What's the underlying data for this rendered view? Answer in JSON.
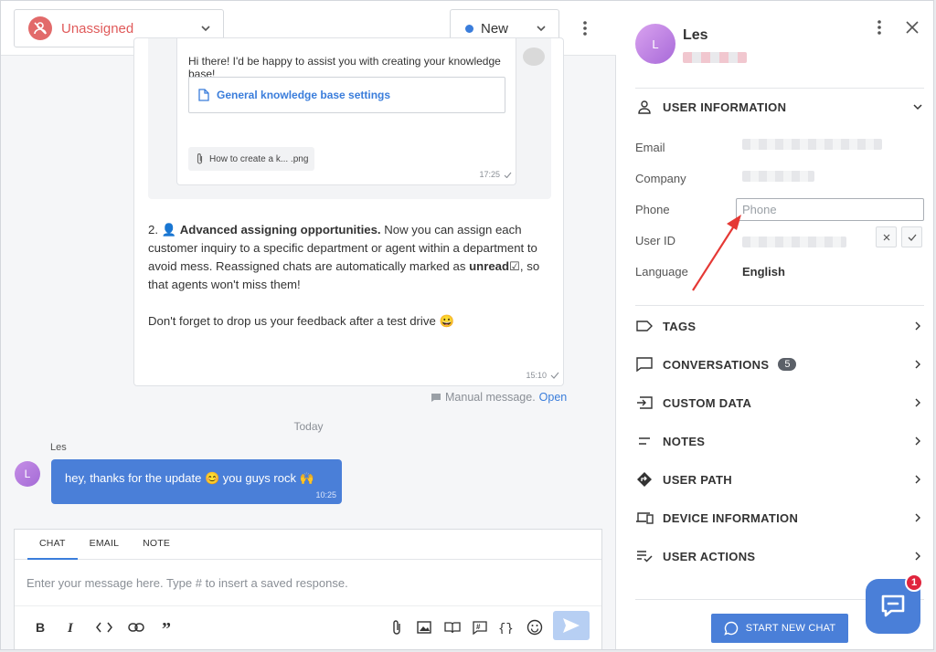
{
  "header": {
    "assignee_label": "Unassigned",
    "status_label": "New",
    "status_color": "#3a7ddb"
  },
  "thread": {
    "inner_message": "Hi there! I'd be happy to assist you with creating your knowledge base!",
    "kb_link_label": "General knowledge base settings",
    "attachment_name": "How to create a k... .png",
    "inner_time": "17:25",
    "paragraph_1_prefix": "2. ",
    "paragraph_1_bold": "Advanced assigning opportunities.",
    "paragraph_1_text": " Now you can assign each customer inquiry to a specific department or agent within a department to avoid mess. Reassigned chats are automatically marked as ",
    "paragraph_1_bold2": "unread",
    "paragraph_1_end": ", so that agents won't miss them!",
    "paragraph_2": "Don't forget to drop us your feedback after a test drive 😀",
    "message_time": "15:10",
    "manual_label": "Manual message.",
    "manual_open": "Open",
    "day_separator": "Today",
    "visitor_name": "Les",
    "visitor_initial": "L",
    "visitor_message": "hey, thanks for the update 😊  you guys rock 🙌",
    "visitor_time": "10:25"
  },
  "composer": {
    "tabs": [
      "CHAT",
      "EMAIL",
      "NOTE"
    ],
    "active_tab": "CHAT",
    "placeholder": "Enter your message here. Type # to insert a saved response."
  },
  "profile": {
    "name": "Les",
    "initial": "L",
    "user_info_title": "USER INFORMATION",
    "fields": {
      "email_label": "Email",
      "company_label": "Company",
      "phone_label": "Phone",
      "phone_placeholder": "Phone",
      "user_id_label": "User ID",
      "language_label": "Language",
      "language_value": "English"
    },
    "sections": {
      "tags": "TAGS",
      "conversations": "CONVERSATIONS",
      "conversations_count": "5",
      "custom_data": "CUSTOM DATA",
      "notes": "NOTES",
      "user_path": "USER PATH",
      "device_information": "DEVICE INFORMATION",
      "user_actions": "USER ACTIONS"
    },
    "start_chat_label": "START NEW CHAT",
    "widget_badge": "1",
    "accent_color": "#4a7fd8",
    "annotation_arrow_color": "#e53935"
  }
}
